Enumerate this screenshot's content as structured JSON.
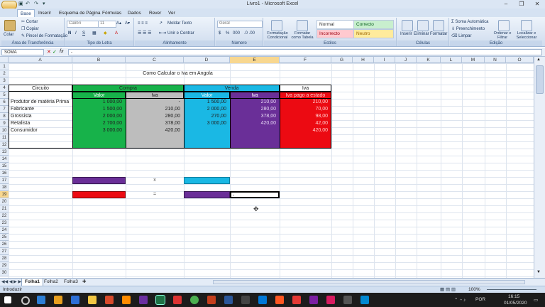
{
  "window": {
    "title": "Livro1 - Microsoft Excel",
    "minimize": "–",
    "restore": "❐",
    "close": "✕"
  },
  "qat": {
    "save": "▣",
    "undo": "↶",
    "redo": "↷",
    "more": "▾"
  },
  "ribbon_tabs": [
    "Base",
    "Inserir",
    "Esquema de Página",
    "Fórmulas",
    "Dados",
    "Rever",
    "Ver"
  ],
  "ribbon": {
    "clipboard": {
      "label": "Área de Transferência",
      "paste": "Colar",
      "cut": "Cortar",
      "copy": "Copiar",
      "format_painter": "Pincel de Formatação"
    },
    "font": {
      "label": "Tipo de Letra",
      "name": "Calibri",
      "size": "11",
      "bold": "N",
      "italic": "I",
      "underline": "S"
    },
    "alignment": {
      "label": "Alinhamento",
      "wrap": "Moldar Texto",
      "merge": "Unir e Centrar"
    },
    "number": {
      "label": "Número",
      "format": "Geral",
      "currency": "$",
      "percent": "%",
      "thousands": "000"
    },
    "styles": {
      "label": "Estilos",
      "conditional": "Formatação Condicional",
      "as_table": "Formatar como Tabela",
      "normal": "Normal",
      "correct": "Correcto",
      "incorrect": "Incorrecto",
      "neutral": "Neutro"
    },
    "cells": {
      "label": "Células",
      "insert": "Inserir",
      "delete": "Eliminar",
      "format": "Formatar"
    },
    "editing": {
      "label": "Edição",
      "autosum": "Soma Automática",
      "fill": "Preenchimento",
      "clear": "Limpar",
      "sort": "Ordenar e Filtrar",
      "find": "Localizar e Seleccionar"
    }
  },
  "formula_bar": {
    "name_box": "SOMA",
    "fx": "fx",
    "value": "-"
  },
  "columns": [
    "A",
    "B",
    "C",
    "D",
    "E",
    "F",
    "G",
    "H",
    "I",
    "J",
    "K",
    "L",
    "M",
    "N",
    "O"
  ],
  "selected_column": "E",
  "rows": [
    "1",
    "2",
    "3",
    "4",
    "5",
    "6",
    "7",
    "8",
    "9",
    "10",
    "11",
    "12",
    "13",
    "14",
    "15",
    "16",
    "17",
    "18",
    "19",
    "20",
    "21",
    "22",
    "23",
    "24",
    "25",
    "26",
    "27",
    "28",
    "29",
    "30"
  ],
  "selected_row": "19",
  "sheet": {
    "title": "Como Calcular o Iva em Angola",
    "circuito": "Circuito",
    "compra": "Compra",
    "venda": "Venda",
    "iva": "Iva",
    "valor": "Valor",
    "iva_sub": "Iva",
    "iva_estado": "Iva pago a estado",
    "row_labels": [
      "Produtor de matéria Prima",
      "Fabricante",
      "Grossista",
      "Retalista",
      "Consumidor"
    ],
    "compra_valor": [
      "1 000,00",
      "1 500,00",
      "2 000,00",
      "2 700,00",
      "3 000,00"
    ],
    "compra_iva": [
      "-",
      "210,00",
      "280,00",
      "378,00",
      "420,00"
    ],
    "venda_valor": [
      "1 500,00",
      "2 000,00",
      "270,00",
      "3 000,00",
      ""
    ],
    "venda_iva": [
      "210,00",
      "280,00",
      "378,00",
      "420,00",
      ""
    ],
    "iva_pago": [
      "210,00",
      "70,00",
      "98,00",
      "42,00",
      "420,00"
    ],
    "op_times": "x",
    "op_equals": "=",
    "active_cell_text": "-"
  },
  "colors": {
    "green": "#17b24a",
    "grey": "#bdbdbd",
    "cyan": "#1ab8e4",
    "purple": "#6a2f98",
    "red": "#ec0a12",
    "selection": "#f8d78f"
  },
  "sheet_tabs": [
    "Folha1",
    "Folha2",
    "Folha3"
  ],
  "status": {
    "mode": "Introduzir",
    "zoom": "100%"
  },
  "taskbar": {
    "lang": "POR",
    "time": "16:15",
    "date": "01/05/2020"
  }
}
